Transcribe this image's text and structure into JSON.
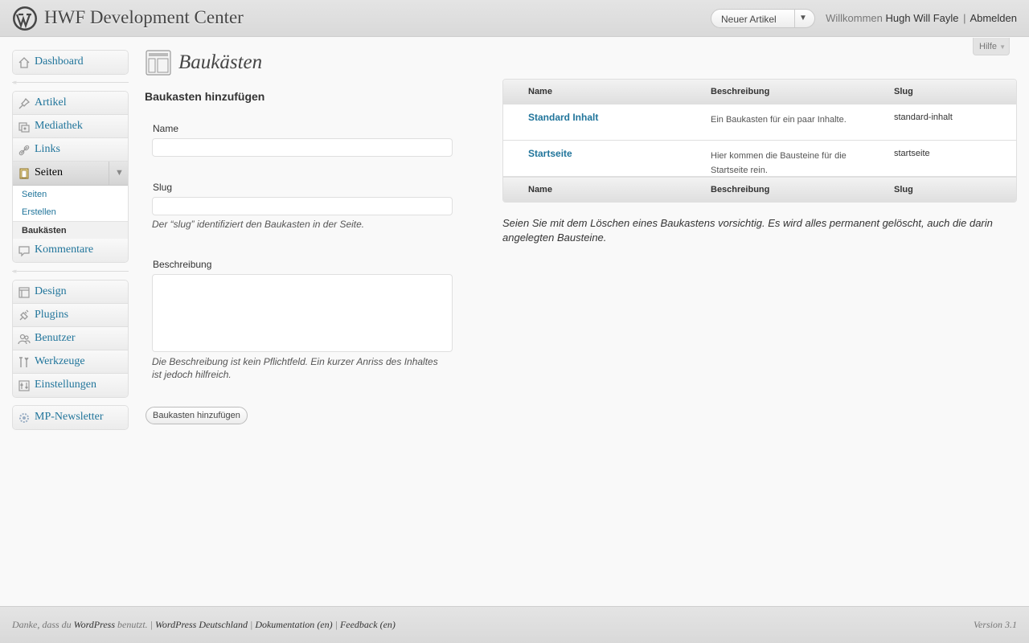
{
  "header": {
    "site_title": "HWF Development Center",
    "new_article": "Neuer Artikel",
    "welcome": "Willkommen",
    "user": "Hugh Will Fayle",
    "logout": "Abmelden",
    "logo_icon": "wordpress-logo-icon"
  },
  "help_tab": "Hilfe",
  "sidebar": {
    "dashboard": "Dashboard",
    "group1": [
      {
        "label": "Artikel",
        "icon": "pin-icon"
      },
      {
        "label": "Mediathek",
        "icon": "media-icon"
      },
      {
        "label": "Links",
        "icon": "link-icon"
      }
    ],
    "seiten": {
      "label": "Seiten",
      "submenu": [
        "Seiten",
        "Erstellen",
        "Baukästen"
      ]
    },
    "kommentare": "Kommentare",
    "group2": [
      {
        "label": "Design",
        "icon": "design-icon"
      },
      {
        "label": "Plugins",
        "icon": "plugin-icon"
      },
      {
        "label": "Benutzer",
        "icon": "users-icon"
      },
      {
        "label": "Werkzeuge",
        "icon": "tools-icon"
      },
      {
        "label": "Einstellungen",
        "icon": "settings-icon"
      }
    ],
    "newsletter": "MP-Newsletter"
  },
  "main": {
    "title": "Baukästen",
    "form": {
      "title": "Baukasten hinzufügen",
      "name_label": "Name",
      "name_value": "",
      "slug_label": "Slug",
      "slug_value": "",
      "slug_help": "Der “slug” identifiziert den Baukasten in der Seite.",
      "desc_label": "Beschreibung",
      "desc_value": "",
      "desc_help": "Die Beschreibung ist kein Pflichtfeld. Ein kurzer Anriss des Inhaltes ist jedoch hilfreich.",
      "submit": "Baukasten hinzufügen"
    },
    "table": {
      "columns": [
        "Name",
        "Beschreibung",
        "Slug"
      ],
      "rows": [
        {
          "name": "Standard Inhalt",
          "desc": "Ein Baukasten für ein paar Inhalte.",
          "slug": "standard-inhalt"
        },
        {
          "name": "Startseite",
          "desc": "Hier kommen die Bausteine für die Startseite rein.",
          "slug": "startseite"
        }
      ]
    },
    "warning": "Seien Sie mit dem Löschen eines Baukastens vorsichtig. Es wird alles permanent gelöscht, auch die darin angelegten Bausteine."
  },
  "footer": {
    "thanks_prefix": "Danke, dass du",
    "thanks_link": "WordPress",
    "thanks_suffix": "benutzt.",
    "link_de": "WordPress Deutschland",
    "link_doc": "Dokumentation",
    "link_feedback": "Feedback",
    "lang": "(en)",
    "version": "Version 3.1"
  },
  "colors": {
    "link": "#21759b",
    "header_bg": "#dfdfdf",
    "page_bg": "#f9f9f9"
  }
}
